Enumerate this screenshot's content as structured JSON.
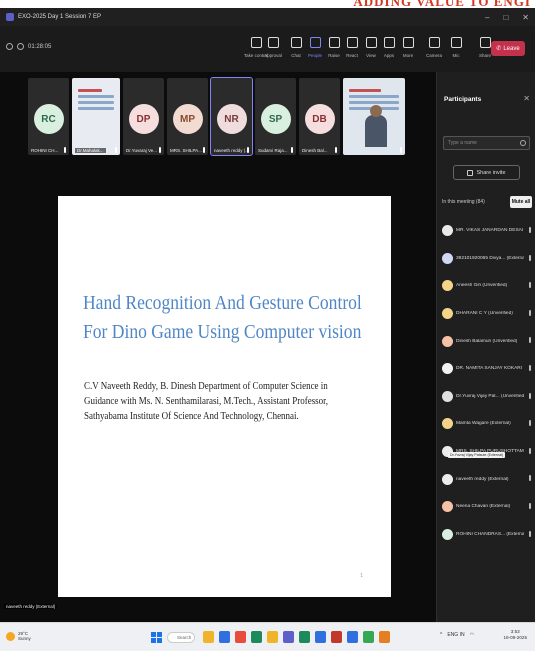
{
  "banner": {
    "text": "ADDING VALUE TO ENGI"
  },
  "window": {
    "title": "EXO-2025 Day 1 Session 7 EP",
    "min": "–",
    "max": "□",
    "close": "✕"
  },
  "meeting": {
    "timer": "01:28:05",
    "buttons": [
      {
        "label": "Take control",
        "icon": "hand-icon"
      },
      {
        "label": "Approval",
        "icon": "clipboard-icon"
      },
      {
        "label": "Chat",
        "icon": "chat-icon"
      },
      {
        "label": "People",
        "icon": "people-icon",
        "count": "84"
      },
      {
        "label": "Raise",
        "icon": "raise-hand-icon"
      },
      {
        "label": "React",
        "icon": "react-icon"
      },
      {
        "label": "View",
        "icon": "view-icon"
      },
      {
        "label": "Apps",
        "icon": "apps-icon"
      },
      {
        "label": "More",
        "icon": "more-icon"
      },
      {
        "label": "Camera",
        "icon": "camera-icon"
      },
      {
        "label": "Mic",
        "icon": "mic-icon"
      },
      {
        "label": "Share",
        "icon": "share-icon"
      }
    ],
    "leave_label": "Leave"
  },
  "tiles": [
    {
      "kind": "avatar",
      "initials": "RC",
      "name": "ROHINI CH...",
      "color": "#d9efe0",
      "text_color": "#2f6b48"
    },
    {
      "kind": "video",
      "name": "Dr.Mahalak..."
    },
    {
      "kind": "avatar",
      "initials": "DP",
      "name": "Dr.Yuvaraj Ve...",
      "color": "#f6dede",
      "text_color": "#8a2f2f"
    },
    {
      "kind": "avatar",
      "initials": "MP",
      "name": "MRS. SHILPA...",
      "color": "#f2dcd2",
      "text_color": "#8a4a2f"
    },
    {
      "kind": "avatar",
      "initials": "NR",
      "name": "naveeth reddy (...",
      "color": "#efdcdc",
      "text_color": "#7a3a3a",
      "selected": true
    },
    {
      "kind": "avatar",
      "initials": "SP",
      "name": "Sudarvi Raja...",
      "color": "#d9efe0",
      "text_color": "#2f6b48"
    },
    {
      "kind": "avatar",
      "initials": "DB",
      "name": "Dinesh Bal...",
      "color": "#f6dede",
      "text_color": "#8a2f2f"
    },
    {
      "kind": "video-wide",
      "name": ""
    }
  ],
  "slide": {
    "title_line1": "Hand Recognition And Gesture Control",
    "title_line2": "For Dino Game Using Computer vision",
    "body": "C.V Naveeth Reddy, B. Dinesh Department of Computer Science in Guidance with Ms. N. Senthamilarasi, M.Tech., Assistant Professor, Sathyabama Institute Of Science And Technology, Chennai.",
    "page": "1",
    "presenter": "naveeth reddy (External)"
  },
  "participants": {
    "title": "Participants",
    "search_placeholder": "Type a name",
    "share_invite": "Share invite",
    "section": "In this meeting (84)",
    "mute_all": "Mute all",
    "list": [
      {
        "name": "MR. VIKAS JANARDAN DESAI",
        "color": "#e9e9e9"
      },
      {
        "name": "392101920065 Divya... (External)",
        "color": "#cfd8f5"
      },
      {
        "name": "Aneesh Giri (Unverified)",
        "color": "#f5d48a"
      },
      {
        "name": "DHARANI C Y (Unverified)",
        "color": "#f5d48a"
      },
      {
        "name": "Dinesh Balamuri (Unverified)",
        "color": "#f5c2a6"
      },
      {
        "name": "DR. NAMITA SANJAY KOKARI",
        "color": "#f3f3f3"
      },
      {
        "name": "Dr.Yuvraj Vijay Pat... (Unverified)",
        "color": "#e0e0e0"
      },
      {
        "name": "Mamta Wagare (External)",
        "color": "#f5d48a"
      },
      {
        "name": "MRS. SHILPA PURUSHOTTAM...",
        "color": "#ececec"
      },
      {
        "name": "naveeth reddy (External)",
        "color": "#ececec"
      },
      {
        "name": "Neena Chavan (External)",
        "color": "#f5c2a6"
      },
      {
        "name": "ROHINI CHANDRAS... (External)",
        "color": "#d9efe0"
      }
    ],
    "tooltip": "Dr.Yuvraj Vijay Patsute (External)"
  },
  "taskbar": {
    "weather_temp": "29°C",
    "weather_desc": "Sunny",
    "search": "Search",
    "time": "3:53",
    "date": "19-09-2025",
    "lang": "ENG IN",
    "apps": [
      "#f0b429",
      "#2f6fde",
      "#e74c3c",
      "#1d8a5b",
      "#f0b429",
      "#5b5fc7",
      "#1d8a5b",
      "#2f6fde",
      "#c0392b",
      "#2f6fde",
      "#34a853",
      "#e67e22"
    ]
  }
}
